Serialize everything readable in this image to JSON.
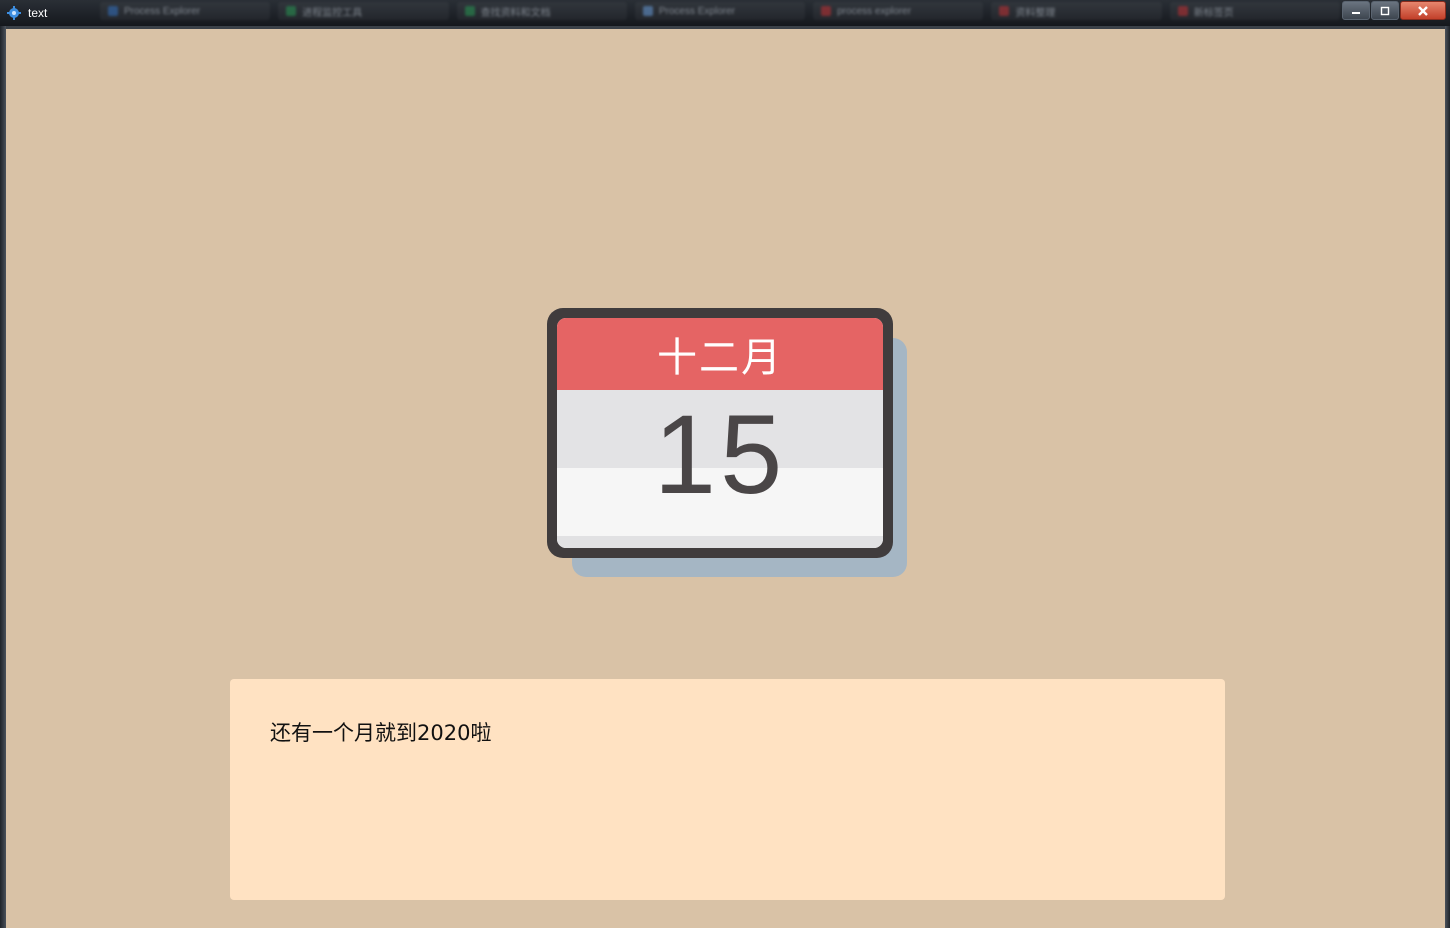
{
  "window": {
    "title": "text",
    "icon": "gear-icon",
    "background_tabs": [
      {
        "label": "Process Explorer",
        "icon_color": "#3a78c8"
      },
      {
        "label": "进程监控工具",
        "icon_color": "#2f9e5a"
      },
      {
        "label": "查找资料和文档",
        "icon_color": "#2f9e5a"
      },
      {
        "label": "Process Explorer",
        "icon_color": "#6fa3e0"
      },
      {
        "label": "process explorer",
        "icon_color": "#c8373a"
      },
      {
        "label": "资料整理",
        "icon_color": "#c8373a"
      },
      {
        "label": "新标签页",
        "icon_color": "#c8373a"
      }
    ],
    "controls": {
      "minimize_icon": "minimize-icon",
      "maximize_icon": "maximize-icon",
      "close_icon": "close-icon"
    }
  },
  "calendar": {
    "month": "十二月",
    "day": "15",
    "colors": {
      "header": "#e56464",
      "frame": "#403c3d",
      "shadow": "#a5b6c4",
      "digits": "#4a4647"
    }
  },
  "message": {
    "text": "还有一个月就到2020啦",
    "background": "#ffe2c2"
  },
  "colors": {
    "page_background": "#d9c2a6"
  }
}
